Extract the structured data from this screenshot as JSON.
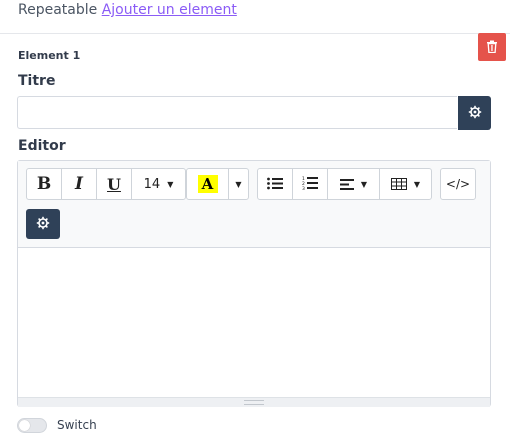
{
  "header": {
    "prefix": "Repeatable",
    "add_link": "Ajouter un element"
  },
  "element": {
    "title": "Element 1",
    "delete_icon": "trash-icon"
  },
  "titre": {
    "label": "Titre",
    "value": "",
    "button_icon": "gear-icon"
  },
  "editor": {
    "label": "Editor",
    "toolbar": {
      "bold": "B",
      "italic": "I",
      "underline": "U",
      "font_size": "14",
      "color_letter": "A",
      "color_highlight": "#ffff00",
      "code": "</>"
    },
    "extra_button_icon": "gear-icon",
    "content": ""
  },
  "switch": {
    "label": "Switch",
    "on": false
  },
  "colors": {
    "accent_link": "#8b5cf6",
    "dark_button": "#2f4158",
    "danger": "#e5534b"
  }
}
